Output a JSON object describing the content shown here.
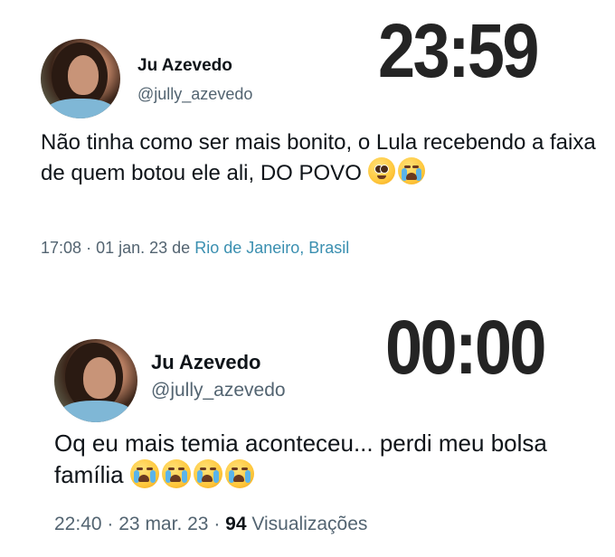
{
  "tweets": [
    {
      "clock": "23:59",
      "author": {
        "name": "Ju Azevedo",
        "handle": "@jully_azevedo"
      },
      "text": "Não tinha como ser mais bonito, o Lula recebendo a faixa de quem botou ele ali, DO POVO",
      "emojis": [
        "pleading-face-emoji",
        "loudly-crying-face-emoji"
      ],
      "meta": {
        "time": "17:08",
        "sep": "·",
        "date": "01 jan. 23",
        "de": "de",
        "place": "Rio de Janeiro, Brasil"
      }
    },
    {
      "clock": "00:00",
      "author": {
        "name": "Ju Azevedo",
        "handle": "@jully_azevedo"
      },
      "text": "Oq eu mais temia aconteceu... perdi meu bolsa família",
      "emojis": [
        "loudly-crying-face-emoji",
        "loudly-crying-face-emoji",
        "loudly-crying-face-emoji",
        "loudly-crying-face-emoji"
      ],
      "meta": {
        "time": "22:40",
        "sep": "·",
        "date": "23 mar. 23",
        "sep2": "·",
        "views": "94",
        "views_label": "Visualizações"
      }
    }
  ],
  "colors": {
    "text": "#0f1419",
    "muted": "#536471",
    "link": "#3a8fb0",
    "clock": "#242424"
  }
}
